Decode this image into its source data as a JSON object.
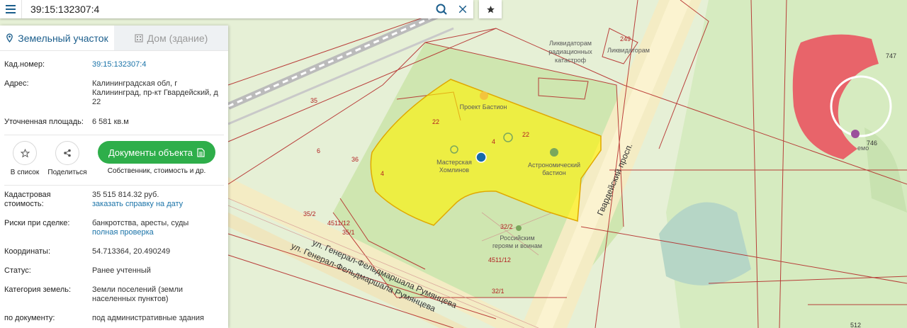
{
  "search": {
    "value": "39:15:132307:4"
  },
  "tabs": [
    {
      "label": "Земельный участок"
    },
    {
      "label": "Дом (здание)"
    }
  ],
  "info": {
    "cad_label": "Кад.номер:",
    "cad_value": "39:15:132307:4",
    "addr_label": "Адрес:",
    "addr_value": "Калининградская обл, г Калининград, пр-кт Гвардейский, д 22",
    "area_label": "Уточненная площадь:",
    "area_value": "6 581 кв.м",
    "cost_label": "Кадастровая стоимость:",
    "cost_value": "35 515 814.32 руб.",
    "cost_link": "заказать справку на дату",
    "risk_label": "Риски при сделке:",
    "risk_value": "банкротства, аресты, суды",
    "risk_link": "полная проверка",
    "coord_label": "Координаты:",
    "coord_value": "54.713364, 20.490249",
    "status_label": "Статус:",
    "status_value": "Ранее учтенный",
    "cat_label": "Категория земель:",
    "cat_value": "Земли поселений (земли населенных пунктов)",
    "doc_label": "по документу:",
    "doc_value": "под административные здания"
  },
  "actions": {
    "favorite": "В список",
    "share": "Поделиться",
    "docs_button": "Документы объекта",
    "docs_sub": "Собственник, стоимость и др."
  },
  "map": {
    "labels": {
      "liquidators1": "Ликвидаторам",
      "liquidators2": "радиационных",
      "liquidators3": "катастроф",
      "liquidators_short": "Ликвидаторам",
      "bastion": "Проект Бастион",
      "workshop1": "Мастерская",
      "workshop2": "Хомлинов",
      "astro1": "Астрономический",
      "astro2": "бастион",
      "heroes1": "Российским",
      "heroes2": "героям и воинам",
      "guards": "Гвардейский просп.",
      "rumyantsev1": "ул. Генерал-Фельдмаршала Румянцева",
      "rumyantsev2": "ул. Генерал-Фельдмаршала Румянцева",
      "demo": "емо"
    },
    "numbers": [
      "747",
      "746",
      "249",
      "35",
      "36",
      "6",
      "22",
      "22",
      "4",
      "4",
      "35/2",
      "4511/12",
      "35/1",
      "32/2",
      "4511/12",
      "32/1",
      "512"
    ]
  },
  "colors": {
    "parcel_fill": "#fff200",
    "parcel_stroke": "#e0a800",
    "boundary": "#b22222",
    "accent": "#1b5e8c",
    "green_btn": "#2eae4a"
  }
}
